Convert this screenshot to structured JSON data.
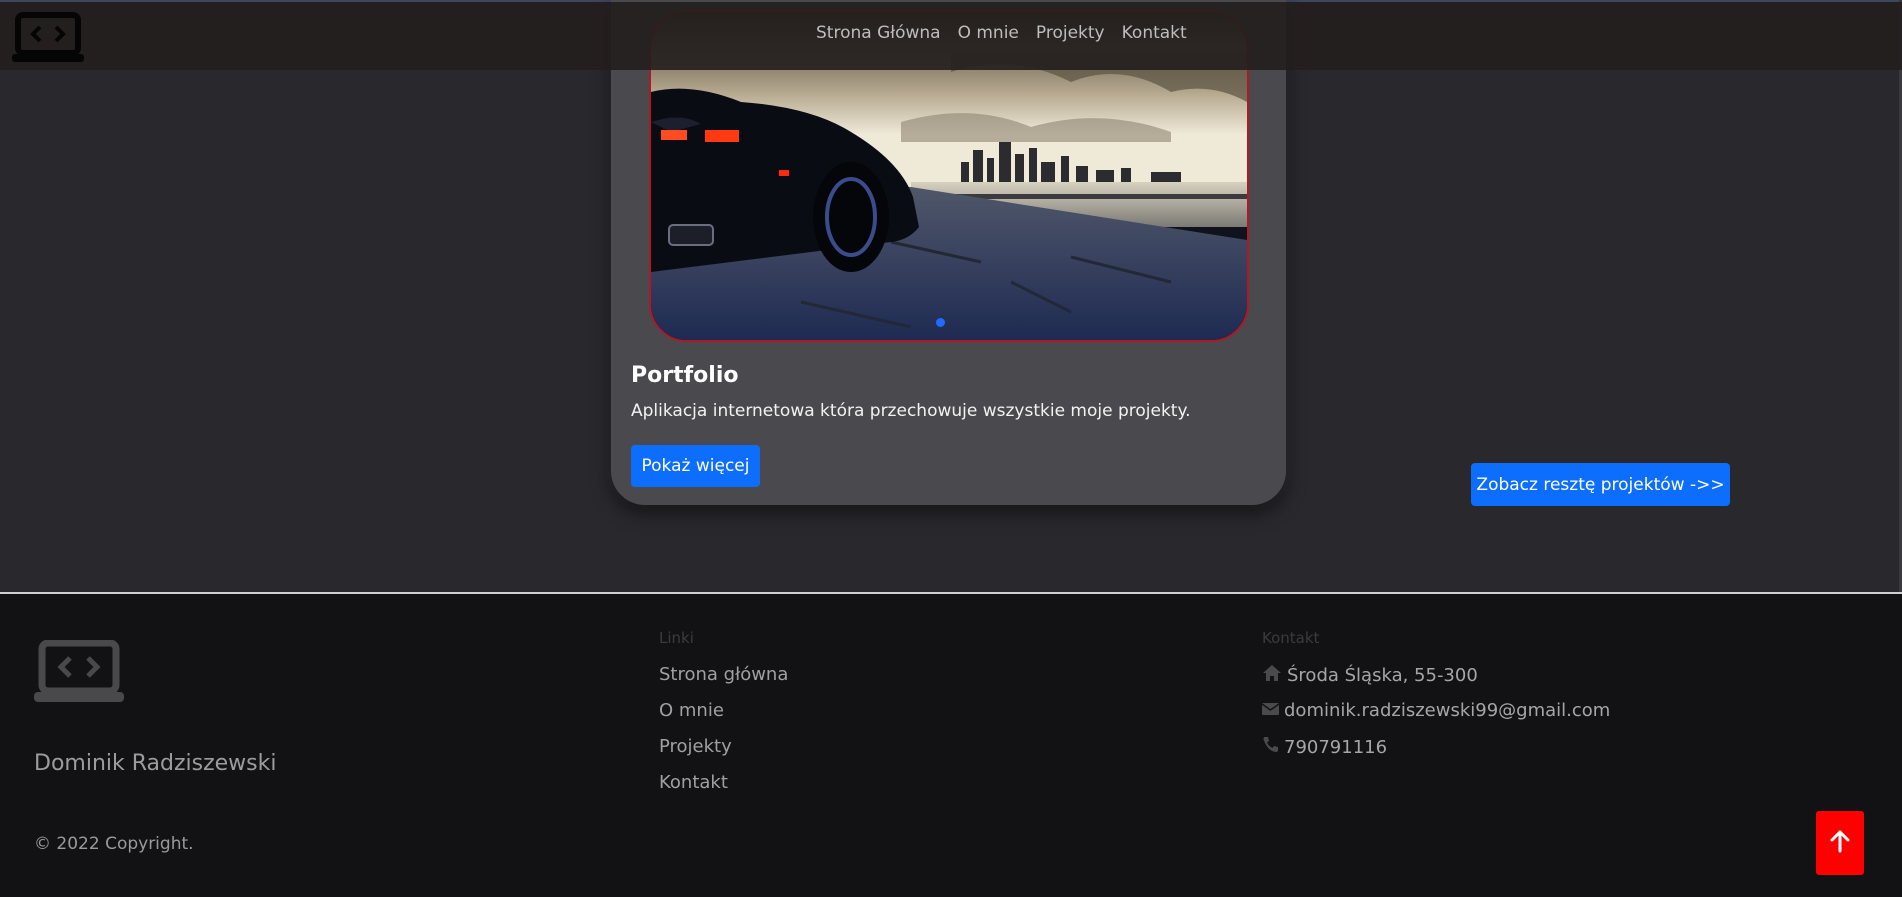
{
  "nav": {
    "logo_icon": "laptop-code-icon",
    "links": [
      "Strona Główna",
      "O mnie",
      "Projekty",
      "Kontakt"
    ]
  },
  "project": {
    "image_alt": "car-by-waterfront-city-image",
    "title": "Portfolio",
    "description": "Aplikacja internetowa która przechowuje wszystkie moje projekty.",
    "button_label": "Pokaż więcej"
  },
  "see_rest_label": "Zobacz resztę projektów ->>",
  "footer": {
    "logo_icon": "laptop-code-icon",
    "name": "Dominik Radziszewski",
    "copyright": "© 2022 Copyright.",
    "links_heading": "Linki",
    "links": [
      "Strona główna",
      "O mnie",
      "Projekty",
      "Kontakt"
    ],
    "contact_heading": "Kontakt",
    "address": "Środa Śląska, 55-300",
    "email": "dominik.radziszewski99@gmail.com",
    "phone": "790791116"
  },
  "back_to_top_icon": "arrow-up-icon",
  "colors": {
    "background": "#29282d",
    "footer_background": "#121215",
    "accent_blue": "#0d6efd",
    "back_to_top_red": "#ff0000",
    "slide_border": "#b01827"
  }
}
